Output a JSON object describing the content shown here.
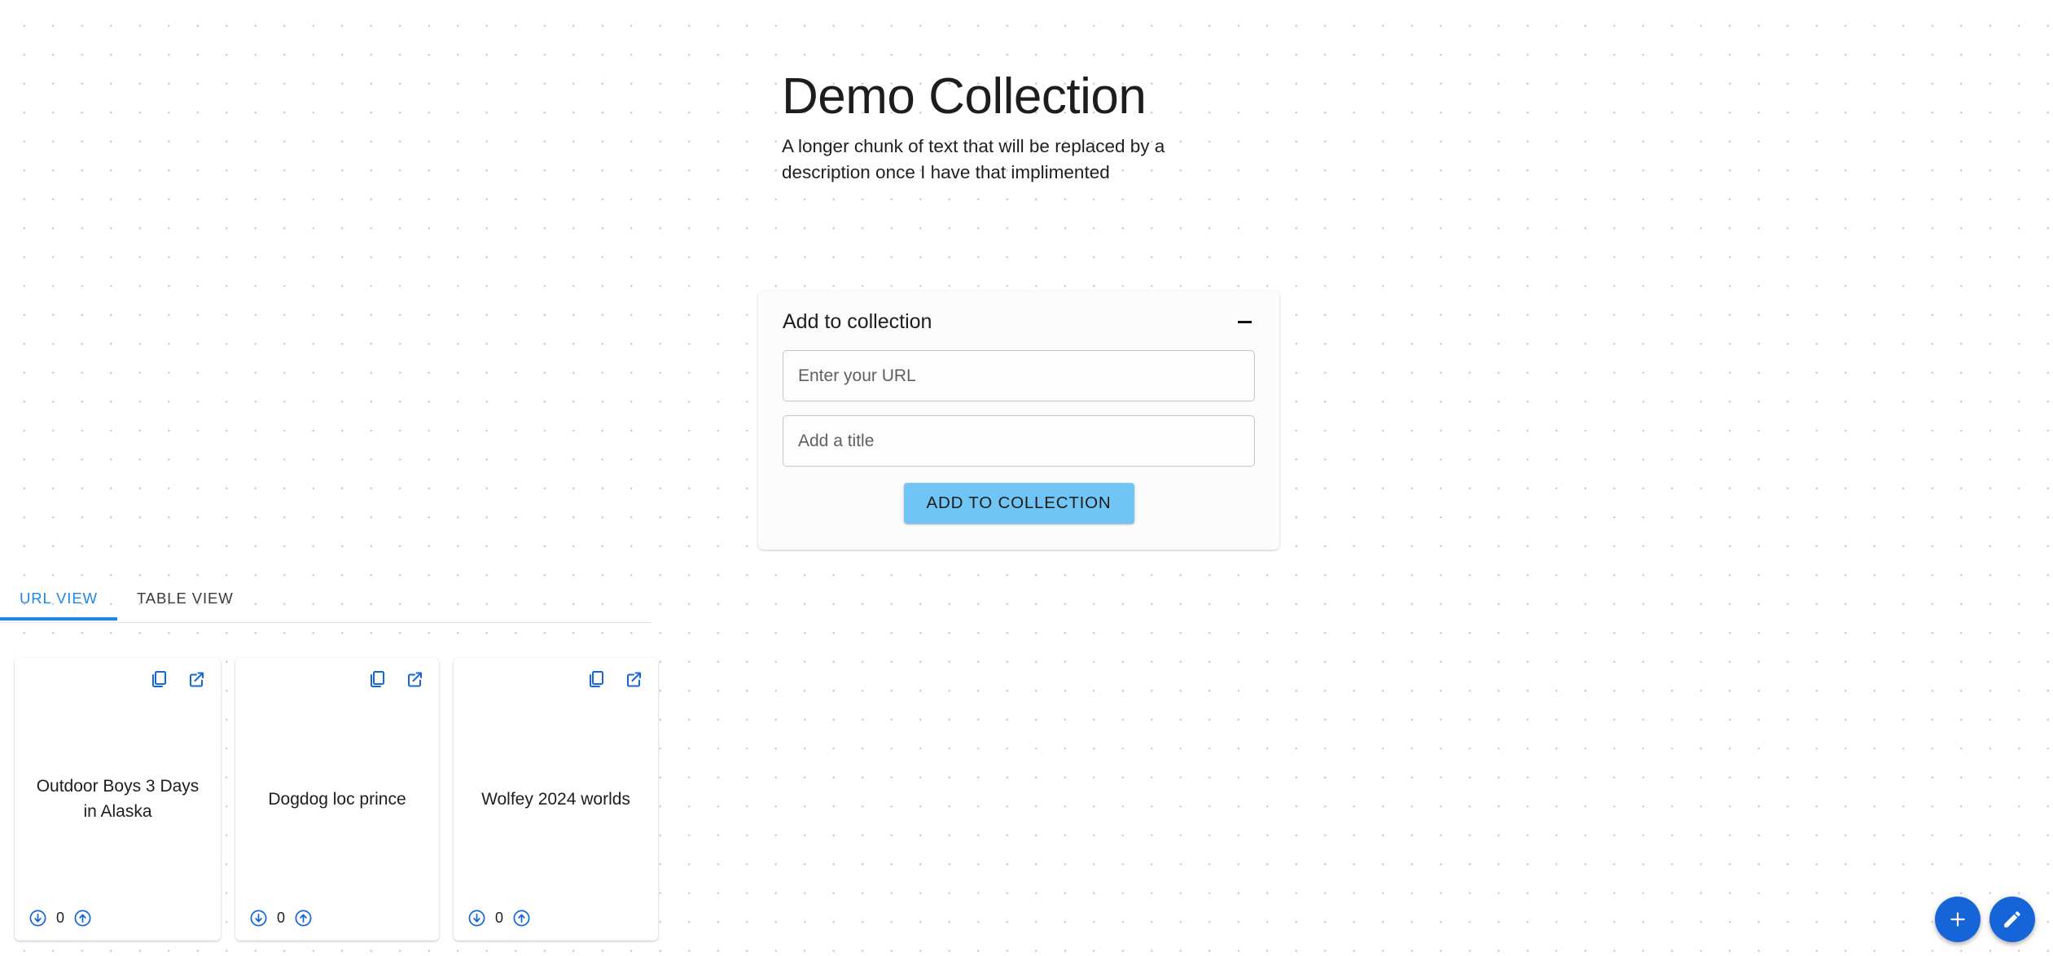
{
  "page": {
    "title": "Demo Collection",
    "description": "A longer chunk of text that will be replaced by a description once I have that implimented"
  },
  "add_panel": {
    "title": "Add to collection",
    "collapse_icon": "minus-icon",
    "url_input_placeholder": "Enter your URL",
    "url_input_value": "",
    "title_input_placeholder": "Add a title",
    "title_input_value": "",
    "submit_label": "ADD TO COLLECTION",
    "submit_color": "#70c5f5"
  },
  "tabs": [
    {
      "label": "URL VIEW",
      "active": true
    },
    {
      "label": "TABLE VIEW",
      "active": false
    }
  ],
  "tab_accent_color": "#1e88e5",
  "cards": [
    {
      "title": "Outdoor Boys 3 Days in Alaska",
      "vote_count": "0",
      "copy_icon": "copy-icon",
      "open_icon": "open-in-new-icon",
      "downvote_icon": "arrow-circle-down-icon",
      "upvote_icon": "arrow-circle-up-icon"
    },
    {
      "title": "Dogdog loc prince",
      "vote_count": "0",
      "copy_icon": "copy-icon",
      "open_icon": "open-in-new-icon",
      "downvote_icon": "arrow-circle-down-icon",
      "upvote_icon": "arrow-circle-up-icon"
    },
    {
      "title": "Wolfey 2024 worlds",
      "vote_count": "0",
      "copy_icon": "copy-icon",
      "open_icon": "open-in-new-icon",
      "downvote_icon": "arrow-circle-down-icon",
      "upvote_icon": "arrow-circle-up-icon"
    }
  ],
  "fabs": [
    {
      "icon": "plus-icon",
      "color": "#1565d8"
    },
    {
      "icon": "pencil-icon",
      "color": "#1565d8"
    }
  ],
  "icon_color": "#1565d8"
}
